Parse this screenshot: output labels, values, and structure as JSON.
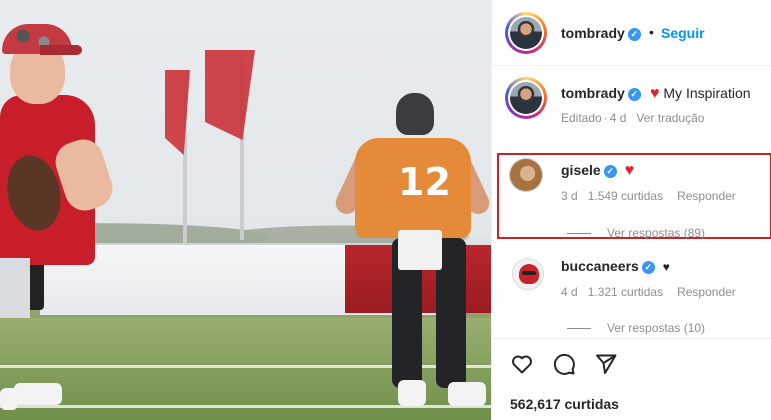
{
  "post": {
    "author": "tombrady",
    "follow_label": "Seguir",
    "separator": "•",
    "likes_count": "562,617 curtidas"
  },
  "caption": {
    "username": "tombrady",
    "text": "My Inspiration",
    "edited": "Editado",
    "sep": "·",
    "age": "4 d",
    "translate": "Ver tradução"
  },
  "comments": [
    {
      "username": "gisele",
      "age": "3 d",
      "likes": "1.549 curtidas",
      "reply_label": "Responder",
      "view_replies": "Ver respostas (89)",
      "highlighted": true
    },
    {
      "username": "buccaneers",
      "age": "4 d",
      "likes": "1.321 curtidas",
      "reply_label": "Responder",
      "view_replies": "Ver respostas (10)"
    }
  ],
  "photo": {
    "jersey_number": "12"
  },
  "icons": {
    "like": "heart-outline-icon",
    "comment": "comment-bubble-icon",
    "share": "paper-plane-icon",
    "verified": "verified-badge-icon",
    "verified_glyph": "✓",
    "heart_red": "♥",
    "heart_black": "♥"
  },
  "colors": {
    "link_blue": "#0095f6",
    "verified_blue": "#3897f0",
    "highlight_red": "#c8232c",
    "heart_red": "#e0212e"
  }
}
